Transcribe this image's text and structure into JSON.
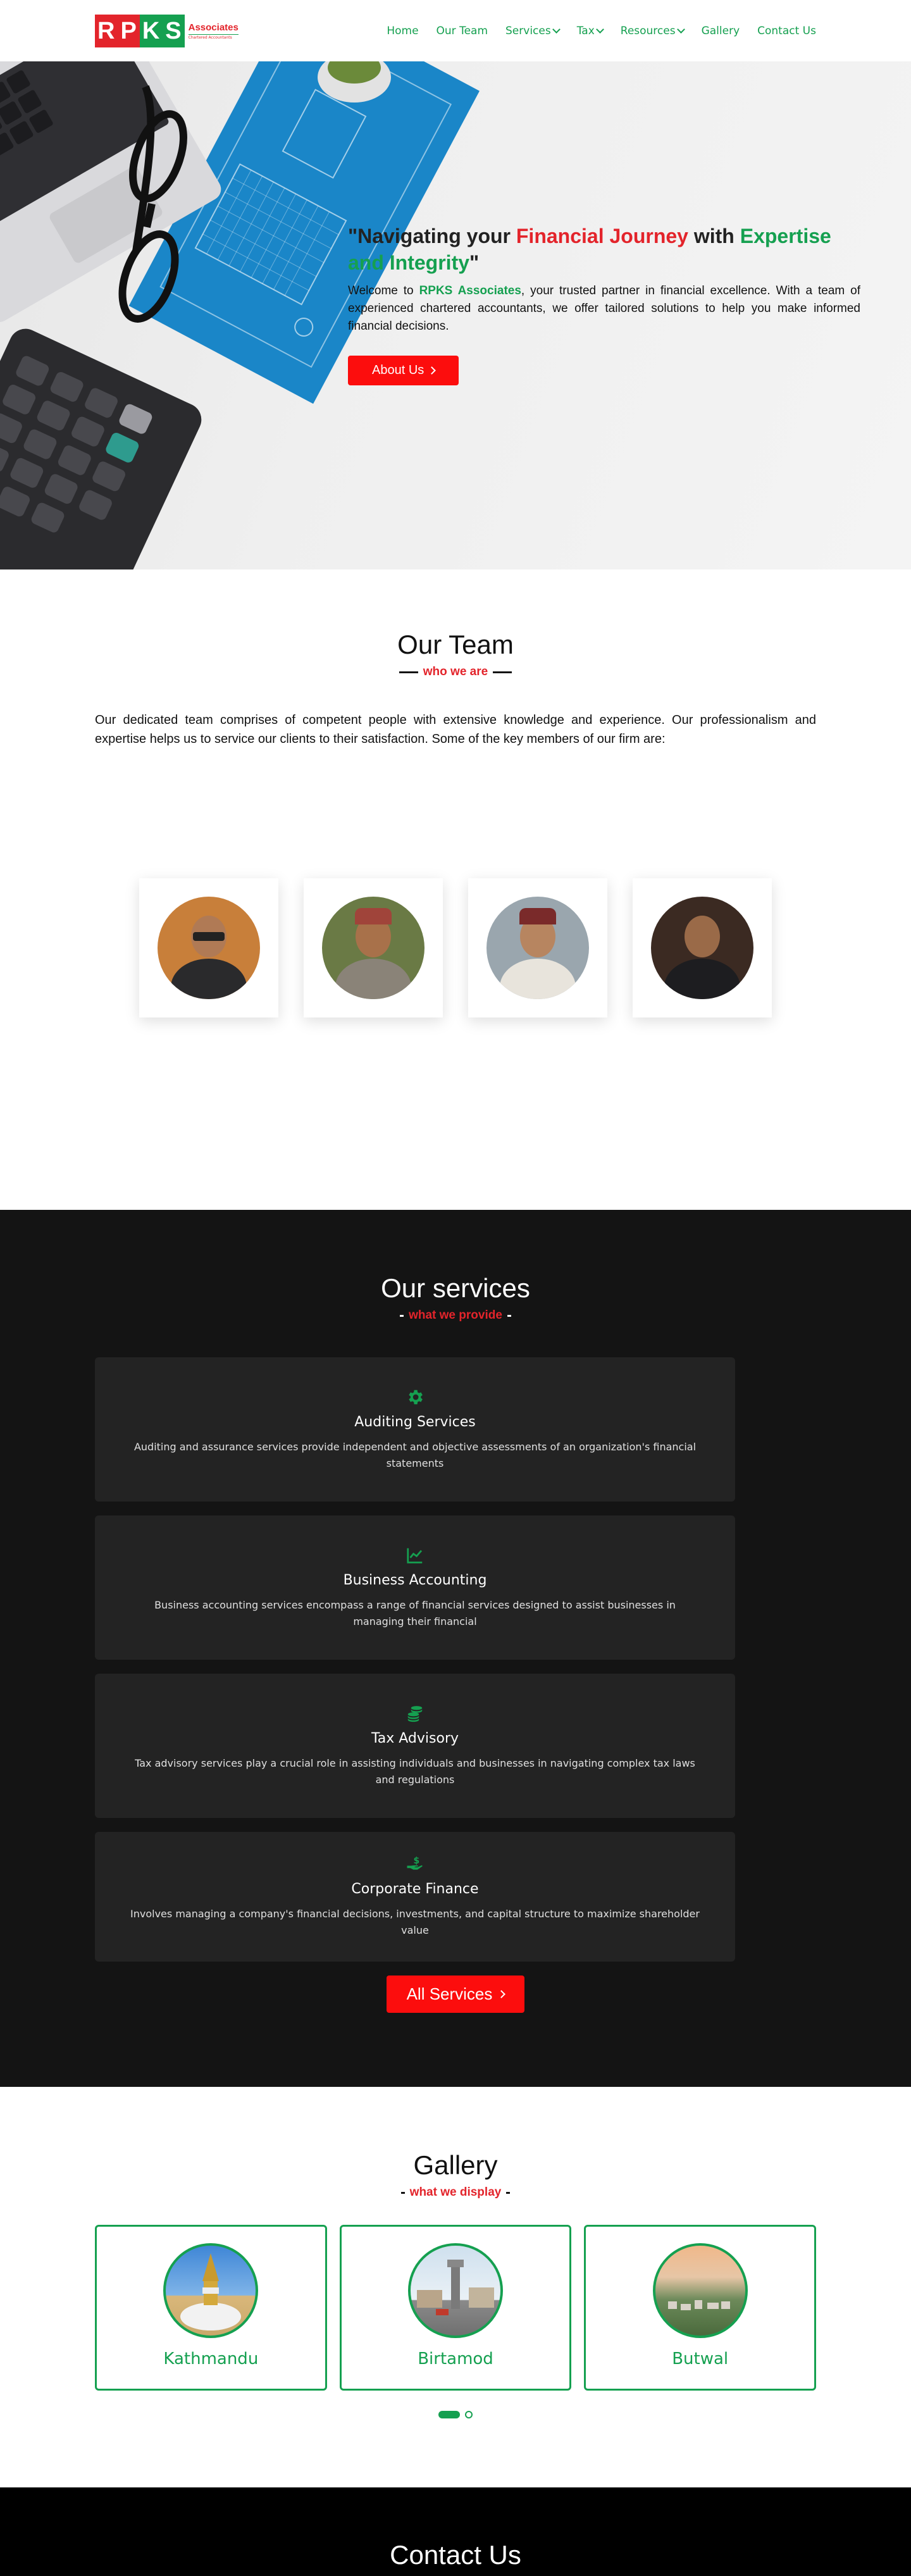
{
  "brand": {
    "logo_letters": [
      "R",
      "P",
      "K",
      "S"
    ],
    "logo_word": "Associates",
    "logo_tagline": "Chartered Accountants"
  },
  "nav": {
    "items": [
      {
        "label": "Home",
        "dropdown": false
      },
      {
        "label": "Our Team",
        "dropdown": false
      },
      {
        "label": "Services",
        "dropdown": true
      },
      {
        "label": "Tax",
        "dropdown": true
      },
      {
        "label": "Resources",
        "dropdown": true
      },
      {
        "label": "Gallery",
        "dropdown": false
      },
      {
        "label": "Contact Us",
        "dropdown": false
      }
    ]
  },
  "hero": {
    "quote_open": "\"Navigating your ",
    "highlight_red": "Financial Journey",
    "mid": " with ",
    "highlight_green": "Expertise and Integrity",
    "quote_close": "\"",
    "welcome_prefix": "Welcome to ",
    "welcome_brand": "RPKS Associates",
    "welcome_suffix": ", your trusted partner in financial excellence. With a team of experienced chartered accountants, we offer tailored solutions to help you make informed financial decisions.",
    "button_label": "About Us"
  },
  "team": {
    "title": "Our Team",
    "subtitle": "who we are",
    "description": "Our dedicated team comprises of competent people with extensive knowledge and experience. Our professionalism and expertise helps us to service our clients to their satisfaction. Some of the key members of our firm are:"
  },
  "services": {
    "title": "Our services",
    "subtitle": "what we provide",
    "items": [
      {
        "icon": "gear-icon",
        "title": "Auditing Services",
        "description": "Auditing and assurance services provide independent and objective assessments of an organization's financial statements"
      },
      {
        "icon": "chart-line-icon",
        "title": "Business Accounting",
        "description": "Business accounting services encompass a range of financial services designed to assist businesses in managing their financial"
      },
      {
        "icon": "coins-icon",
        "title": "Tax Advisory",
        "description": "Tax advisory services play a crucial role in assisting individuals and businesses in navigating complex tax laws and regulations"
      },
      {
        "icon": "hand-dollar-icon",
        "title": "Corporate Finance",
        "description": "Involves managing a company's financial decisions, investments, and capital structure to maximize shareholder value"
      }
    ],
    "button_label": "All Services"
  },
  "gallery": {
    "title": "Gallery",
    "subtitle": "what we display",
    "items": [
      {
        "name": "Kathmandu"
      },
      {
        "name": "Birtamod"
      },
      {
        "name": "Butwal"
      }
    ]
  },
  "contact": {
    "title": "Contact Us"
  },
  "colors": {
    "green": "#15a050",
    "red": "#e3242b",
    "button_red": "#fc0d0d",
    "dark": "#141414"
  }
}
